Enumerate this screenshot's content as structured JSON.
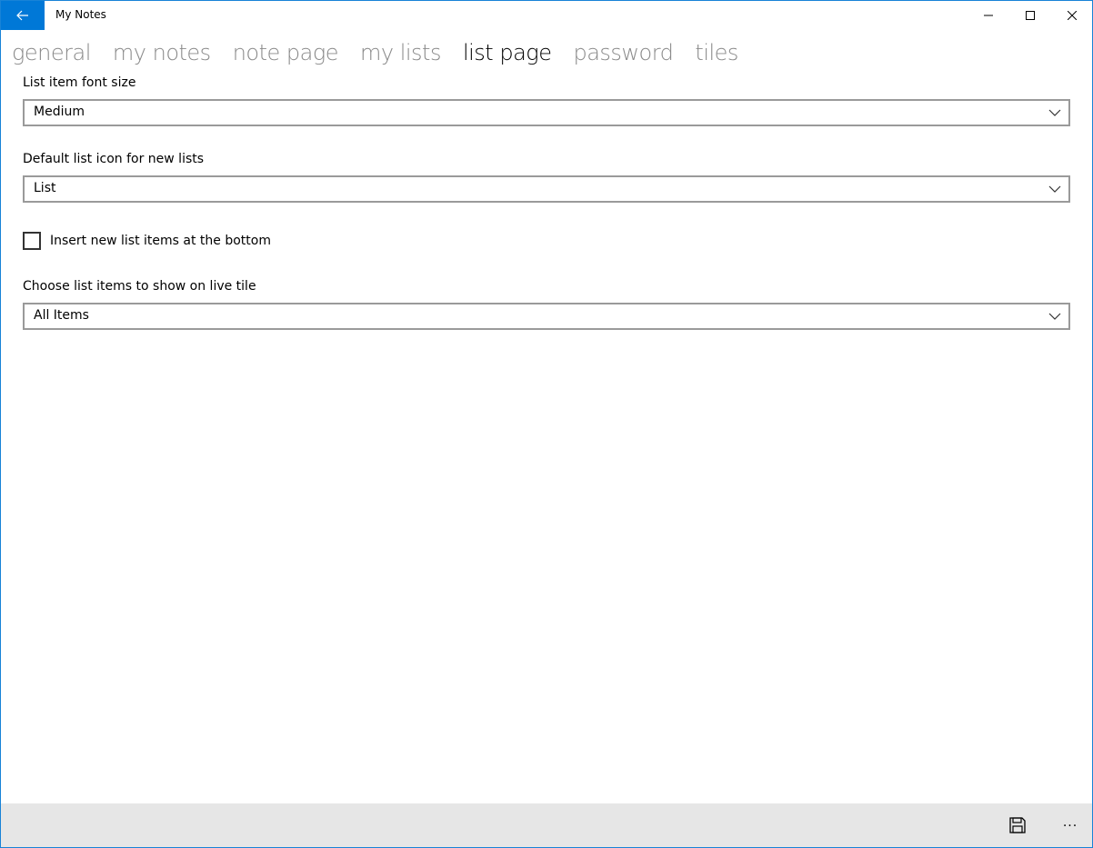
{
  "window": {
    "title": "My Notes",
    "accent_color": "#0078d7"
  },
  "icons": {
    "back": "back-arrow-icon",
    "minimize": "minimize-icon",
    "maximize": "maximize-icon",
    "close": "close-icon",
    "chevron": "chevron-down-icon",
    "save": "save-icon",
    "more": "more-icon"
  },
  "pivot": {
    "tabs": [
      {
        "label": "general"
      },
      {
        "label": "my notes"
      },
      {
        "label": "note page"
      },
      {
        "label": "my lists"
      },
      {
        "label": "list page"
      },
      {
        "label": "password"
      },
      {
        "label": "tiles"
      }
    ],
    "active": "list page"
  },
  "settings": {
    "font_size": {
      "label": "List item font size",
      "value": "Medium"
    },
    "default_icon": {
      "label": "Default list icon for new lists",
      "value": "List"
    },
    "insert_bottom": {
      "label": "Insert new list items at the bottom",
      "checked": false
    },
    "live_tile": {
      "label": "Choose list items to show on live tile",
      "value": "All Items"
    }
  },
  "command_bar": {
    "more_label": "..."
  }
}
